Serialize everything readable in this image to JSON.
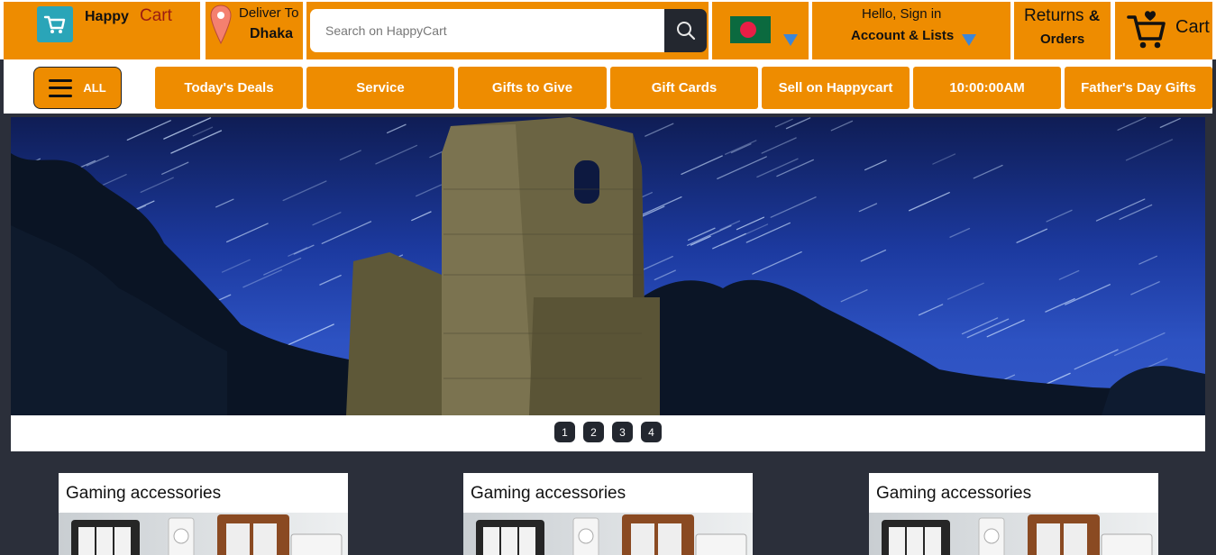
{
  "header": {
    "logo_happy": "Happy",
    "logo_cart": "Cart",
    "deliver_label": "Deliver To",
    "deliver_city": "Dhaka",
    "search_placeholder": "Search on HappyCart",
    "account_hello": "Hello, Sign in",
    "account_lists": "Account & Lists",
    "returns_word": "Returns",
    "returns_amp": "&",
    "orders_word": "Orders",
    "cart_label": "Cart"
  },
  "nav": {
    "all_label": "ALL",
    "items": [
      "Today's Deals",
      "Service",
      "Gifts to Give",
      "Gift Cards",
      "Sell on Happycart",
      "10:00:00AM",
      "Father's Day Gifts"
    ]
  },
  "carousel": {
    "pages": [
      "1",
      "2",
      "3",
      "4"
    ]
  },
  "products": [
    {
      "title": "Gaming accessories"
    },
    {
      "title": "Gaming accessories"
    },
    {
      "title": "Gaming accessories"
    }
  ],
  "colors": {
    "brand_orange": "#ee8c00",
    "dark": "#23272f",
    "page_bg": "#2b2f3a",
    "cart_red": "#9b1c12"
  }
}
